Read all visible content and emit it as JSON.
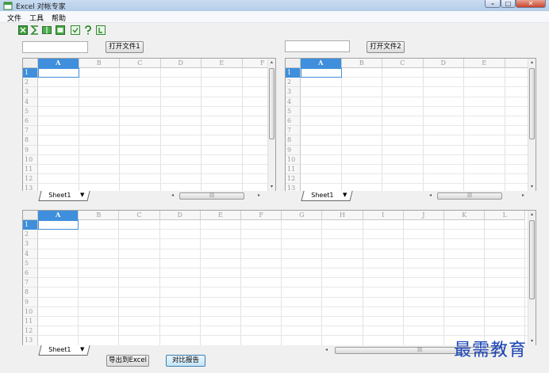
{
  "window": {
    "title": "Excel 对帐专家"
  },
  "menu": {
    "items": [
      "文件",
      "工具",
      "帮助"
    ]
  },
  "toolbar": {
    "icons": [
      "excel-icon",
      "formula-icon",
      "book-icon",
      "sheet-icon",
      "save-icon",
      "help-icon",
      "exit-icon"
    ]
  },
  "top_left": {
    "file_path": "",
    "open_label": "打开文件1",
    "columns": [
      "A",
      "B",
      "C",
      "D",
      "E",
      "F"
    ],
    "rows": [
      "1",
      "2",
      "3",
      "4",
      "5",
      "6",
      "7",
      "8",
      "9",
      "10",
      "11",
      "12",
      "13"
    ],
    "sheet_tab": "Sheet1"
  },
  "top_right": {
    "file_path": "",
    "open_label": "打开文件2",
    "columns": [
      "A",
      "B",
      "C",
      "D",
      "E",
      ""
    ],
    "rows": [
      "1",
      "2",
      "3",
      "4",
      "5",
      "6",
      "7",
      "8",
      "9",
      "10",
      "11",
      "12",
      "13"
    ],
    "sheet_tab": "Sheet1"
  },
  "bottom": {
    "columns": [
      "A",
      "B",
      "C",
      "D",
      "E",
      "F",
      "G",
      "H",
      "I",
      "J",
      "K",
      "L"
    ],
    "rows": [
      "1",
      "2",
      "3",
      "4",
      "5",
      "6",
      "7",
      "8",
      "9",
      "10",
      "11",
      "12",
      "13"
    ],
    "sheet_tab": "Sheet1",
    "export_label": "导出到Excel",
    "report_label": "对比报告"
  },
  "scroll": {
    "thumb_grip": "|||"
  },
  "watermark": "最需教育",
  "colors": {
    "selection": "#3f8fdc",
    "title_bar": "#b4cde9",
    "watermark": "#1c44b8"
  }
}
